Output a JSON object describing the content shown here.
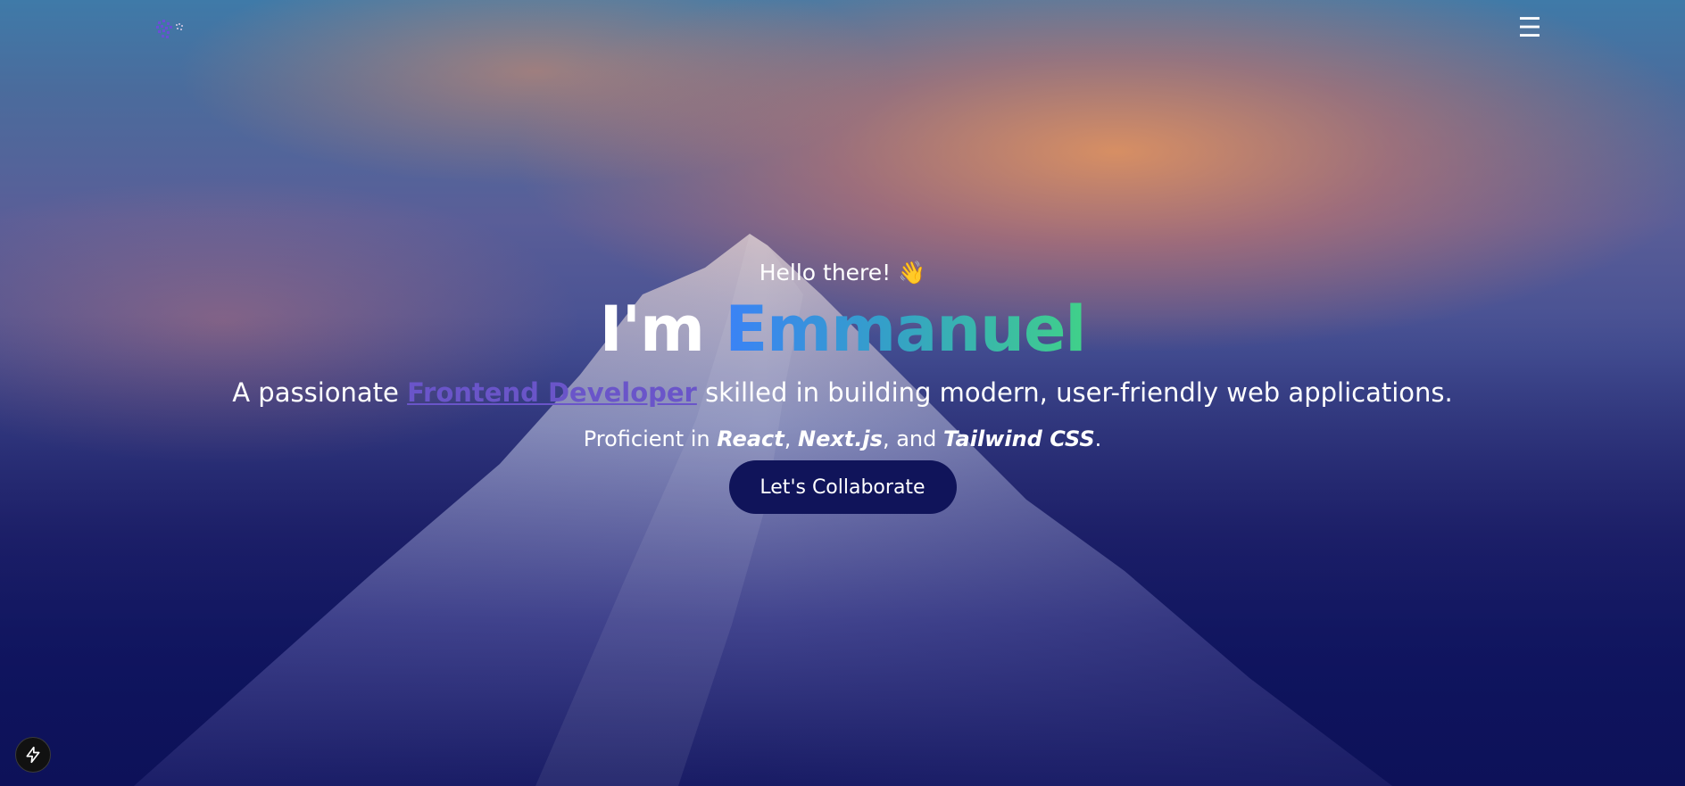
{
  "nav": {
    "logo_icon": "pixel-logo-icon",
    "menu_icon": "hamburger-menu-icon",
    "menu_glyph": "☰"
  },
  "hero": {
    "greeting": "Hello there! 👋",
    "headline_prefix": "I'm ",
    "headline_name": "Emmanuel",
    "tagline_prefix": "A passionate ",
    "tagline_link": "Frontend Developer",
    "tagline_suffix": " skilled in building modern, user-friendly web applications.",
    "skills_prefix": "Proficient in ",
    "skill_1": "React",
    "sep_1": ", ",
    "skill_2": "Next.js",
    "sep_2": ", and ",
    "skill_3": "Tailwind CSS",
    "skills_suffix": ".",
    "cta_label": "Let's Collaborate"
  },
  "dev_badge": {
    "icon": "lightning-bolt-icon"
  },
  "colors": {
    "name_gradient_start": "#3b82f6",
    "name_gradient_end": "#40d189",
    "link": "#6a55c9",
    "cta_background": "#10145a"
  }
}
